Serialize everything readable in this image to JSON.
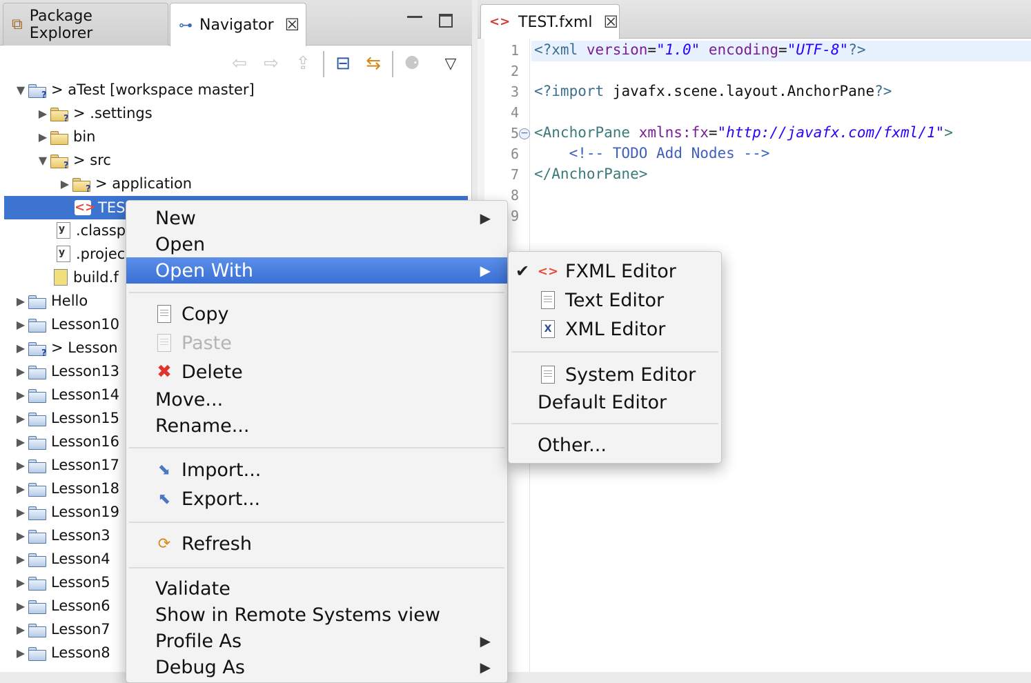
{
  "left_view": {
    "tabs": [
      {
        "label": "Package Explorer"
      },
      {
        "label": "Navigator",
        "close": "☒"
      }
    ],
    "min_glyph": "▭",
    "max_glyph": "▢",
    "toolbar": {
      "back": "⇦",
      "forward": "⇨",
      "up": "⇪",
      "collapse": "⊟",
      "link": "⇆",
      "filter": "⚈",
      "menu": "▽"
    },
    "tree": [
      {
        "twisty": "▼",
        "icon": "project",
        "label": "> aTest  [workspace master]"
      },
      {
        "twisty": "▶",
        "icon": "folder",
        "label": "> .settings"
      },
      {
        "twisty": "▶",
        "icon": "folder",
        "label": "bin"
      },
      {
        "twisty": "▼",
        "icon": "folder",
        "label": "> src"
      },
      {
        "twisty": "▶",
        "icon": "folder",
        "label": "> application"
      },
      {
        "twisty": "",
        "icon": "fxml",
        "label": "TES"
      },
      {
        "twisty": "",
        "icon": "file",
        "label": ".classp"
      },
      {
        "twisty": "",
        "icon": "file",
        "label": ".projec"
      },
      {
        "twisty": "",
        "icon": "file",
        "label": "build.f"
      },
      {
        "twisty": "▶",
        "icon": "project",
        "label": "Hello"
      },
      {
        "twisty": "▶",
        "icon": "project",
        "label": "Lesson10"
      },
      {
        "twisty": "▶",
        "icon": "project",
        "label": "> Lesson"
      },
      {
        "twisty": "▶",
        "icon": "project",
        "label": "Lesson13"
      },
      {
        "twisty": "▶",
        "icon": "project",
        "label": "Lesson14"
      },
      {
        "twisty": "▶",
        "icon": "project",
        "label": "Lesson15"
      },
      {
        "twisty": "▶",
        "icon": "project",
        "label": "Lesson16"
      },
      {
        "twisty": "▶",
        "icon": "project",
        "label": "Lesson17"
      },
      {
        "twisty": "▶",
        "icon": "project",
        "label": "Lesson18"
      },
      {
        "twisty": "▶",
        "icon": "project",
        "label": "Lesson19"
      },
      {
        "twisty": "▶",
        "icon": "project",
        "label": "Lesson3"
      },
      {
        "twisty": "▶",
        "icon": "project",
        "label": "Lesson4"
      },
      {
        "twisty": "▶",
        "icon": "project",
        "label": "Lesson5"
      },
      {
        "twisty": "▶",
        "icon": "project",
        "label": "Lesson6"
      },
      {
        "twisty": "▶",
        "icon": "project",
        "label": "Lesson7"
      },
      {
        "twisty": "▶",
        "icon": "project",
        "label": "Lesson8"
      }
    ],
    "file_icon_glyph": "y",
    "q_glyph": "?"
  },
  "editor": {
    "tab": {
      "label": "TEST.fxml",
      "icon": "<>",
      "close": "☒"
    },
    "line_numbers": [
      "1",
      "2",
      "3",
      "4",
      "5",
      "6",
      "7",
      "8",
      "9"
    ],
    "fold_glyph": "−",
    "lines": {
      "l1": {
        "a": "<?xml ",
        "b": "version",
        "c": "=",
        "d": "\"1.0\"",
        "e": " encoding",
        "f": "=",
        "g": "\"UTF-8\"",
        "h": "?>"
      },
      "l3": {
        "a": "<?import ",
        "b": "javafx.scene.layout.AnchorPane",
        "c": "?>"
      },
      "l5": {
        "a": "<AnchorPane ",
        "b": "xmlns:fx",
        "c": "=",
        "d": "\"http://javafx.com/fxml/1\"",
        "e": ">"
      },
      "l6": {
        "a": "    <!-- TODO Add Nodes -->"
      },
      "l7": {
        "a": "</AnchorPane>"
      }
    }
  },
  "context_menu": {
    "items": [
      {
        "label": "New",
        "arrow": "▶"
      },
      {
        "label": "Open"
      },
      {
        "label": "Open With",
        "arrow": "▶"
      },
      {
        "label": "Copy"
      },
      {
        "label": "Paste"
      },
      {
        "label": "Delete",
        "icon": "✖"
      },
      {
        "label": "Move..."
      },
      {
        "label": "Rename..."
      },
      {
        "label": "Import..."
      },
      {
        "label": "Export..."
      },
      {
        "label": "Refresh"
      },
      {
        "label": "Validate"
      },
      {
        "label": "Show in Remote Systems view"
      },
      {
        "label": "Profile As",
        "arrow": "▶"
      },
      {
        "label": "Debug As",
        "arrow": "▶"
      }
    ]
  },
  "submenu": {
    "check": "✔",
    "items": [
      {
        "label": "FXML Editor",
        "icon": "<>"
      },
      {
        "label": "Text Editor"
      },
      {
        "label": "XML Editor",
        "icon": "X"
      },
      {
        "label": "System Editor"
      },
      {
        "label": "Default Editor"
      },
      {
        "label": "Other..."
      }
    ]
  },
  "colors": {
    "selection": "#3d74d0",
    "menu_highlight": "#3a6fd6",
    "xml_string": "#2a00ff",
    "xml_attr": "#7a1d96"
  }
}
